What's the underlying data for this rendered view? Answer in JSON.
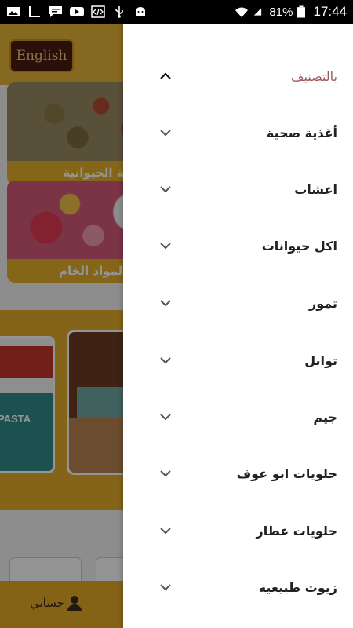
{
  "status_bar": {
    "battery": "81%",
    "time": "17:44",
    "left_icons": [
      "image-icon",
      "bars-icon",
      "message-icon",
      "youtube-icon",
      "code-icon",
      "usb-icon",
      "android-icon"
    ],
    "right_icons": [
      "wifi-icon",
      "signal-icon",
      "battery-icon"
    ]
  },
  "background": {
    "language_button": "English",
    "categories": [
      {
        "label": "أغذية الحيوانية"
      },
      {
        "label": "يات المواد الخام"
      }
    ],
    "promo1_text": "PASTA",
    "account_label": "حسابي"
  },
  "drawer": {
    "header": {
      "label": "بالتصنيف"
    },
    "items": [
      {
        "label": "أغذية صحية"
      },
      {
        "label": "اعشاب"
      },
      {
        "label": "اكل حيوانات"
      },
      {
        "label": "تمور"
      },
      {
        "label": "توابل"
      },
      {
        "label": "جيم"
      },
      {
        "label": "حلويات  ابو عوف"
      },
      {
        "label": "حلويات  عطار"
      },
      {
        "label": "زيوت طبيعية"
      }
    ]
  },
  "colors": {
    "accent": "#e4ad2a",
    "header_label": "#9b5a5a",
    "language_button_bg": "#4a1b10"
  }
}
